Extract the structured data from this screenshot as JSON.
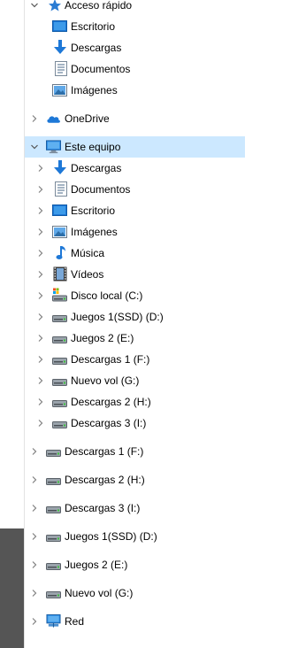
{
  "nav": {
    "quick_access": {
      "label": "Acceso rápido",
      "items": [
        {
          "label": "Escritorio",
          "icon": "desktop-icon"
        },
        {
          "label": "Descargas",
          "icon": "downloads-icon"
        },
        {
          "label": "Documentos",
          "icon": "documents-icon"
        },
        {
          "label": "Imágenes",
          "icon": "pictures-icon"
        }
      ]
    },
    "onedrive": {
      "label": "OneDrive",
      "icon": "onedrive-icon"
    },
    "this_pc": {
      "label": "Este equipo",
      "items": [
        {
          "label": "Descargas",
          "icon": "downloads-icon"
        },
        {
          "label": "Documentos",
          "icon": "documents-icon"
        },
        {
          "label": "Escritorio",
          "icon": "desktop-icon"
        },
        {
          "label": "Imágenes",
          "icon": "pictures-icon"
        },
        {
          "label": "Música",
          "icon": "music-icon"
        },
        {
          "label": "Vídeos",
          "icon": "videos-icon"
        },
        {
          "label": "Disco local (C:)",
          "icon": "system-drive-icon"
        },
        {
          "label": "Juegos 1(SSD) (D:)",
          "icon": "drive-icon"
        },
        {
          "label": "Juegos 2 (E:)",
          "icon": "drive-icon"
        },
        {
          "label": "Descargas 1 (F:)",
          "icon": "drive-icon"
        },
        {
          "label": "Nuevo vol (G:)",
          "icon": "drive-icon"
        },
        {
          "label": "Descargas 2 (H:)",
          "icon": "drive-icon"
        },
        {
          "label": "Descargas 3 (I:)",
          "icon": "drive-icon"
        }
      ]
    },
    "drives": [
      {
        "label": "Descargas 1 (F:)",
        "icon": "drive-icon"
      },
      {
        "label": "Descargas 2 (H:)",
        "icon": "drive-icon"
      },
      {
        "label": "Descargas 3 (I:)",
        "icon": "drive-icon"
      },
      {
        "label": "Juegos 1(SSD) (D:)",
        "icon": "drive-icon"
      },
      {
        "label": "Juegos 2 (E:)",
        "icon": "drive-icon"
      },
      {
        "label": "Nuevo vol (G:)",
        "icon": "drive-icon"
      }
    ],
    "network": {
      "label": "Red",
      "icon": "network-icon"
    }
  },
  "colors": {
    "selection": "#cce8ff",
    "chevron": "#808080",
    "accent_blue": "#1e78d7"
  }
}
